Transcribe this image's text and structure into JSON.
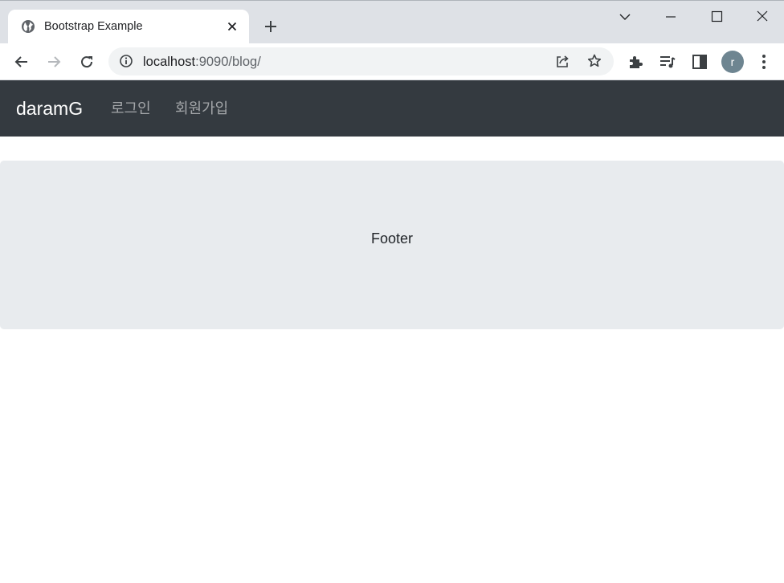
{
  "browser": {
    "tab": {
      "title": "Bootstrap Example",
      "favicon": "globe-icon"
    },
    "window_controls": [
      "tab-search-icon",
      "minimize-icon",
      "maximize-icon",
      "close-icon"
    ],
    "address": {
      "host": "localhost",
      "path": ":9090/blog/"
    },
    "toolbar_icons": [
      "back-icon",
      "forward-icon",
      "reload-icon",
      "info-icon",
      "share-icon",
      "star-icon",
      "extensions-icon",
      "reading-list-icon",
      "side-panel-icon",
      "menu-icon"
    ],
    "profile_initial": "r"
  },
  "navbar": {
    "brand": "daramG",
    "links": [
      {
        "label": "로그인"
      },
      {
        "label": "회원가입"
      }
    ]
  },
  "footer": {
    "text": "Footer"
  },
  "colors": {
    "tabstrip_bg": "#dee1e6",
    "navbar_bg": "#343a40",
    "footer_bg": "#e8ebee",
    "avatar_bg": "#6e8591"
  }
}
